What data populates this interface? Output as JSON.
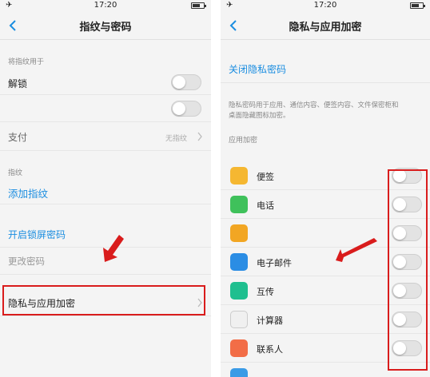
{
  "left": {
    "status_time": "17:20",
    "title": "指纹与密码",
    "section_fingerprint_use": "将指纹用于",
    "unlock_label": "解锁",
    "pay_label": "支付",
    "pay_value": "无指纹",
    "section_fingerprint": "指纹",
    "add_fingerprint": "添加指纹",
    "enable_lock_password": "开启锁屏密码",
    "change_password": "更改密码",
    "privacy_encryption": "隐私与应用加密"
  },
  "right": {
    "status_time": "17:20",
    "title": "隐私与应用加密",
    "close_privacy_password": "关闭隐私密码",
    "description": [
      "隐私密码用于应用、通信内容、便签内容、文件保密柜和",
      "桌面隐藏图标加密。"
    ],
    "section_app_encryption": "应用加密",
    "apps": [
      {
        "label": "便签",
        "icon": "notes-icon",
        "color": "#f5b731"
      },
      {
        "label": "电话",
        "icon": "phone-icon",
        "color": "#3fc15b"
      },
      {
        "label": "",
        "icon": "folder-icon",
        "color": "#f2a623"
      },
      {
        "label": "电子邮件",
        "icon": "mail-icon",
        "color": "#2b8de4"
      },
      {
        "label": "互传",
        "icon": "transfer-icon",
        "color": "#1fbf8f"
      },
      {
        "label": "计算器",
        "icon": "calculator-icon",
        "color": "#f0f0f0"
      },
      {
        "label": "联系人",
        "icon": "contacts-icon",
        "color": "#f26d47"
      },
      {
        "label": "",
        "icon": "browser-icon",
        "color": "#3a9be6"
      }
    ]
  },
  "colors": {
    "accent_blue": "#1a8de0",
    "highlight_red": "#d91c1c",
    "background": "#f4f4f4"
  }
}
